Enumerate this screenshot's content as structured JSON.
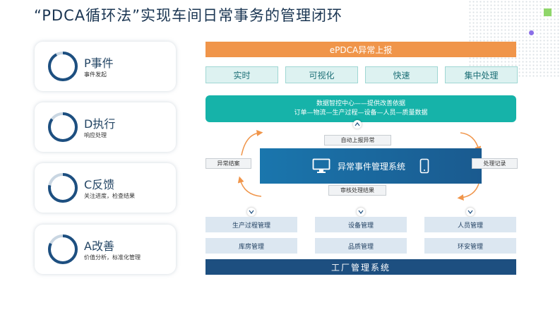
{
  "title": "“PDCA循环法”实现车间日常事务的管理闭环",
  "cards": [
    {
      "title": "P事件",
      "subtitle": "事件发起",
      "progress": 0.92
    },
    {
      "title": "D执行",
      "subtitle": "响应处理",
      "progress": 0.85
    },
    {
      "title": "C反馈",
      "subtitle": "关注进度，检查结果",
      "progress": 0.78
    },
    {
      "title": "A改善",
      "subtitle": "价值分析，标准化管理",
      "progress": 0.82
    }
  ],
  "report_bar": "ePDCA异常上报",
  "features": [
    "实时",
    "可视化",
    "快速",
    "集中处理"
  ],
  "data_center": {
    "line1": "数据智控中心——提供改善依据",
    "line2": "订单—物流—生产过程—设备—人员—质量数据"
  },
  "auto_report": "自动上报异常",
  "system_name": "异常事件管理系统",
  "review_result": "审核处理结果",
  "left_tag": "异常结案",
  "right_tag": "处理记录",
  "modules": [
    [
      "生产过程管理",
      "库房管理"
    ],
    [
      "设备管理",
      "品质管理"
    ],
    [
      "人员管理",
      "环安管理"
    ]
  ],
  "factory_system": "工厂管理系统",
  "colors": {
    "orange": "#f0954a",
    "teal": "#16b3a9",
    "blue": "#1a6aa0",
    "navy": "#1d4f80"
  }
}
